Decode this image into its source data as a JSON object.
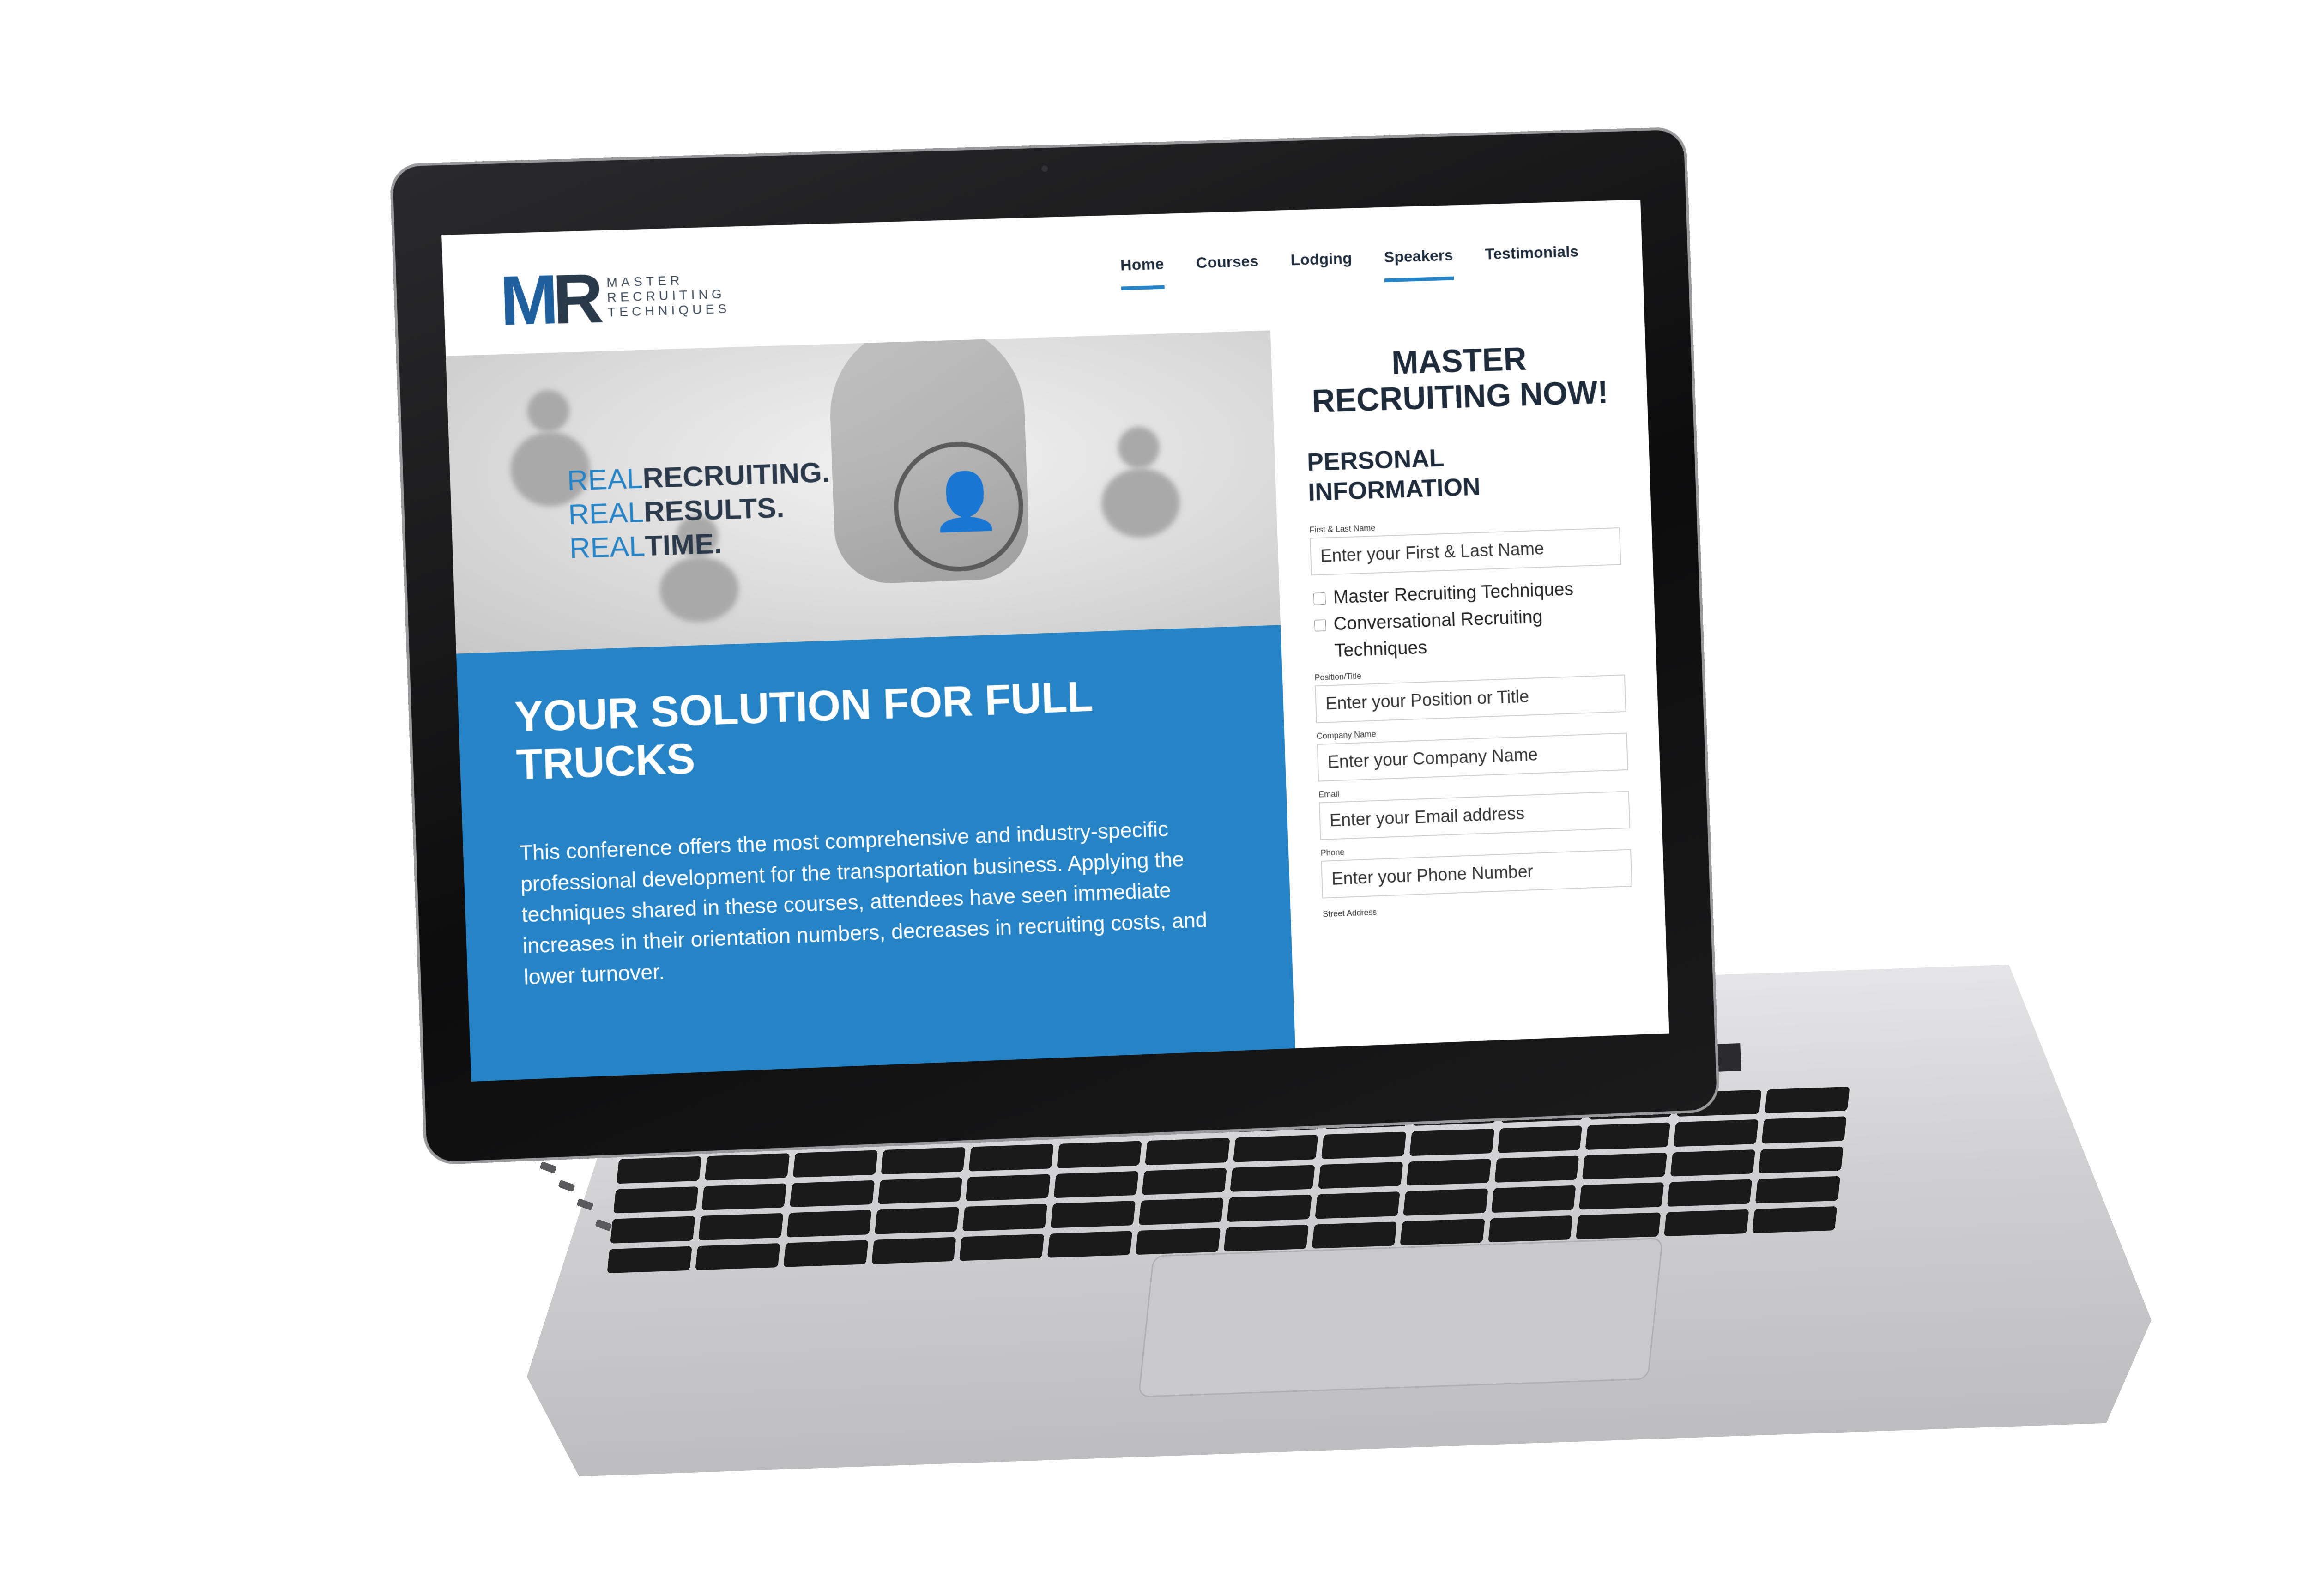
{
  "site": {
    "logo": {
      "mark_m": "M",
      "mark_r": "R",
      "line1": "MASTER",
      "line2": "RECRUITING",
      "line3": "TECHNIQUES"
    },
    "nav": [
      {
        "label": "Home",
        "active": true
      },
      {
        "label": "Courses",
        "active": false
      },
      {
        "label": "Lodging",
        "active": false
      },
      {
        "label": "Speakers",
        "active": true
      },
      {
        "label": "Testimonials",
        "active": false
      }
    ],
    "hero": {
      "tagline": [
        {
          "light": "REAL",
          "bold": "RECRUITING."
        },
        {
          "light": "REAL",
          "bold": "RESULTS."
        },
        {
          "light": "REAL",
          "bold": "TIME."
        }
      ]
    },
    "main": {
      "headline": "YOUR SOLUTION FOR FULL TRUCKS",
      "intro": "This conference offers the most comprehensive and industry-specific professional development for the transportation business. Applying the techniques shared in these courses, attendees have seen immediate increases in their orientation numbers, decreases in recruiting costs, and lower turnover."
    },
    "form": {
      "title": "MASTER RECRUITING NOW!",
      "subtitle": "PERSONAL INFORMATION",
      "name_label": "First & Last Name",
      "name_placeholder": "Enter your First & Last Name",
      "course_options": [
        "Master Recruiting Techniques",
        "Conversational Recruiting Techniques"
      ],
      "position_label": "Position/Title",
      "position_placeholder": "Enter your Position or Title",
      "company_label": "Company Name",
      "company_placeholder": "Enter your Company Name",
      "email_label": "Email",
      "email_placeholder": "Enter your Email address",
      "phone_label": "Phone",
      "phone_placeholder": "Enter your Phone Number",
      "street_label": "Street Address"
    },
    "colors": {
      "accent_blue": "#2583c6",
      "navy": "#1d2b3a",
      "logo_blue": "#1f5f9e"
    }
  }
}
